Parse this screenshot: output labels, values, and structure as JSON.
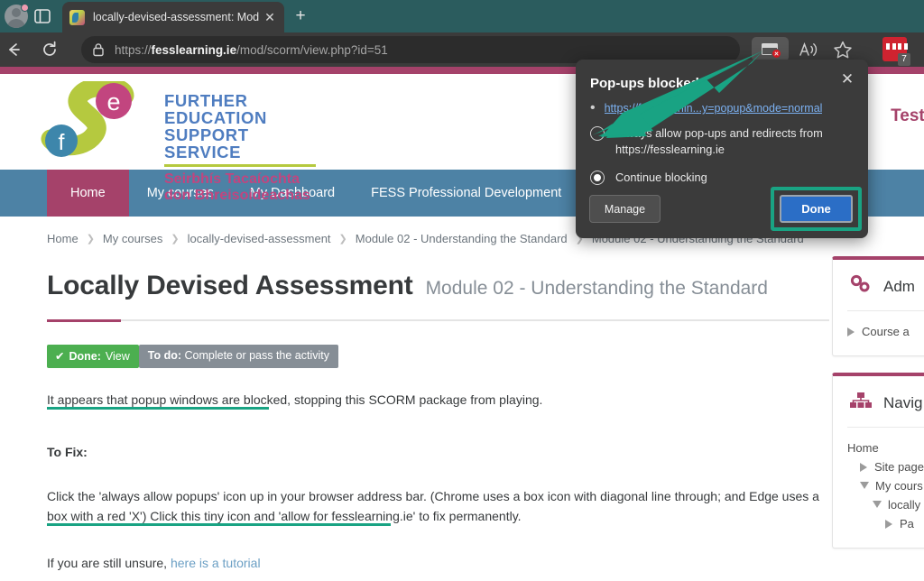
{
  "browser": {
    "tab": {
      "title": "locally-devised-assessment: Mod",
      "close_label": "✕",
      "favicon": "fess-logo-favicon"
    },
    "newtab_label": "+",
    "avatar": "profile-avatar",
    "splitview": "split-screen-icon",
    "back_label": "←",
    "reload_label": "↻",
    "url_prefix": "https://",
    "url_domain": "fesslearning.ie",
    "url_path": "/mod/scorm/view.php?id=51",
    "lock": "lock-icon",
    "popup_blocked_icon": "popup-blocked-icon",
    "read_aloud_icon": "read-aloud-icon",
    "favorites_icon": "favorites-star-icon",
    "extension_badge_count": "7"
  },
  "popup_dialog": {
    "title": "Pop-ups blocked:",
    "close_label": "✕",
    "bullet": "•",
    "blocked_url": "https://fesslearnin...y=popup&mode=normal",
    "options": [
      {
        "label": "Always allow pop-ups and redirects from https://fesslearning.ie",
        "checked": false
      },
      {
        "label": "Continue blocking",
        "checked": true
      }
    ],
    "manage_label": "Manage",
    "done_label": "Done"
  },
  "site": {
    "logo_line1": "FURTHER EDUCATION",
    "logo_line1b": "SUPPORT SERVICE",
    "logo_line2": "Seirbhís Tacaíochta",
    "logo_line2b": "don Bhreisoideachas",
    "user_greeting": "Test Man",
    "nav": [
      {
        "label": "Home",
        "active": true
      },
      {
        "label": "My courses",
        "active": false
      },
      {
        "label": "My Dashboard",
        "active": false
      },
      {
        "label": "FESS Professional Development",
        "active": false
      }
    ],
    "breadcrumb": [
      "Home",
      "My courses",
      "locally-devised-assessment",
      "Module 02 - Understanding the Standard",
      "Module 02 - Understanding the Standard"
    ],
    "breadcrumb_sep": "❯"
  },
  "main": {
    "title": "Locally Devised Assessment",
    "subtitle": "Module 02 - Understanding the Standard",
    "badge_done_check": "✔",
    "badge_done_strong": "Done:",
    "badge_done_text": "View",
    "badge_todo_strong": "To do:",
    "badge_todo_text": "Complete or pass the activity",
    "para1": "It appears that popup windows are blocked, stopping this SCORM package from playing.",
    "para2": "To Fix:",
    "para3": "Click the 'always allow popups' icon up in your browser address bar. (Chrome uses a box icon with diagonal line through; and Edge uses a box with a red 'X') Click this tiny icon and 'allow for fesslearning.ie' to fix permanently.",
    "para4_prefix": "If you are still unsure, ",
    "para4_link": "here is a tutorial"
  },
  "sidebar": {
    "admin": {
      "icon": "gears-icon",
      "title": "Adm",
      "items": [
        {
          "label": "Course a",
          "caret": "right"
        }
      ]
    },
    "navigation": {
      "icon": "sitemap-icon",
      "title": "Navig",
      "items": [
        {
          "label": "Home",
          "caret": "none",
          "indent": 0
        },
        {
          "label": "Site page",
          "caret": "right",
          "indent": 1
        },
        {
          "label": "My cours",
          "caret": "down",
          "indent": 1
        },
        {
          "label": "locally",
          "caret": "down",
          "indent": 2
        },
        {
          "label": "Pa",
          "caret": "right",
          "indent": 3
        }
      ]
    }
  },
  "colors": {
    "brand_maroon": "#a5426a",
    "nav_blue": "#4d82a5",
    "annotation_teal": "#19a383",
    "done_green": "#4caf50",
    "todo_grey": "#868e96",
    "dialog_bg": "#3b3b3b",
    "done_button_blue": "#2b6ec6"
  }
}
